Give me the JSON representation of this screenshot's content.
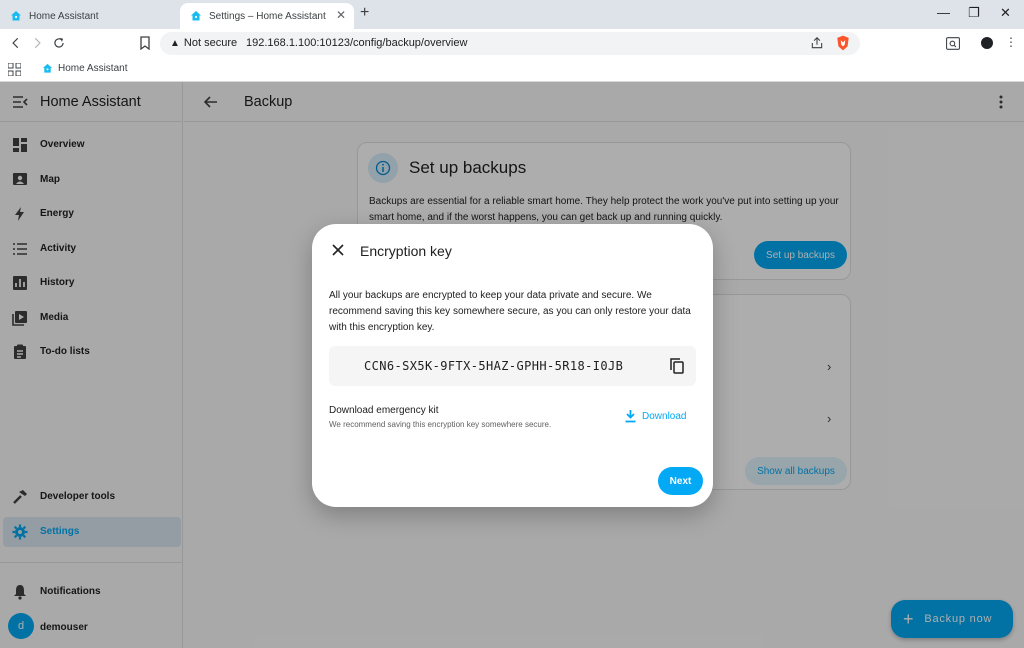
{
  "browser": {
    "tabs": [
      {
        "title": "Home Assistant",
        "icon": "home-assistant-logo-icon"
      },
      {
        "title": "Settings – Home Assistant",
        "icon": "home-assistant-logo-icon"
      }
    ],
    "security_label": "Not secure",
    "url": "192.168.1.100:10123/config/backup/overview",
    "bookmarks": [
      {
        "label": "Home Assistant",
        "icon": "home-assistant-logo-icon"
      }
    ]
  },
  "sidebar": {
    "title": "Home Assistant",
    "items": [
      {
        "label": "Overview",
        "icon": "dashboard-icon"
      },
      {
        "label": "Map",
        "icon": "map-icon"
      },
      {
        "label": "Energy",
        "icon": "lightning-icon"
      },
      {
        "label": "Activity",
        "icon": "list-icon"
      },
      {
        "label": "History",
        "icon": "chart-box-icon"
      },
      {
        "label": "Media",
        "icon": "play-box-icon"
      },
      {
        "label": "To-do lists",
        "icon": "clipboard-list-icon"
      }
    ],
    "bottom_items": [
      {
        "label": "Developer tools",
        "icon": "hammer-icon"
      },
      {
        "label": "Settings",
        "icon": "cog-icon",
        "selected": true
      }
    ],
    "notifications_label": "Notifications",
    "user": {
      "initial": "d",
      "name": "demouser"
    }
  },
  "main": {
    "title": "Backup",
    "setup_card": {
      "title": "Set up backups",
      "text": "Backups are essential for a reliable smart home. They help protect the work you've put into setting up your smart home, and if the worst happens, you can get back up and running quickly.",
      "button_label": "Set up backups"
    },
    "backups_card": {
      "button_label": "Show all backups"
    },
    "fab_label": "Backup now"
  },
  "dialog": {
    "title": "Encryption key",
    "text": "All your backups are encrypted to keep your data private and secure. We recommend saving this key somewhere secure, as you can only restore your data with this encryption key.",
    "encryption_key": "CCN6-SX5K-9FTX-5HAZ-GPHH-5R18-I0JB",
    "kit_title": "Download emergency kit",
    "kit_subtitle": "We recommend saving this encryption key somewhere secure.",
    "download_label": "Download",
    "next_label": "Next"
  },
  "colors": {
    "primary": "#03a9f4",
    "selected_bg": "#dbe7f0",
    "scrim": "rgba(0,0,0,0.32)"
  }
}
